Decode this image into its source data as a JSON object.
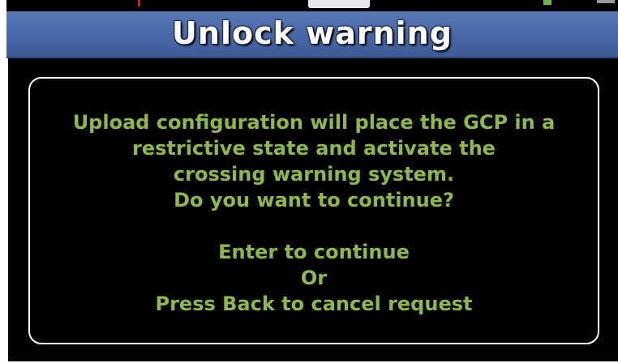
{
  "dialog": {
    "title": "Unlock warning",
    "message_lines": [
      "Upload configuration will place the GCP in a",
      "restrictive state and activate the",
      "crossing warning system.",
      "Do you want to continue?"
    ],
    "continue_prompt": "Enter to continue",
    "or_text": "Or",
    "cancel_prompt": "Press Back to cancel request"
  },
  "colors": {
    "title_bar": "#4967a7",
    "message_text": "#8fb84c",
    "background": "#000000",
    "border": "#ffffff"
  }
}
